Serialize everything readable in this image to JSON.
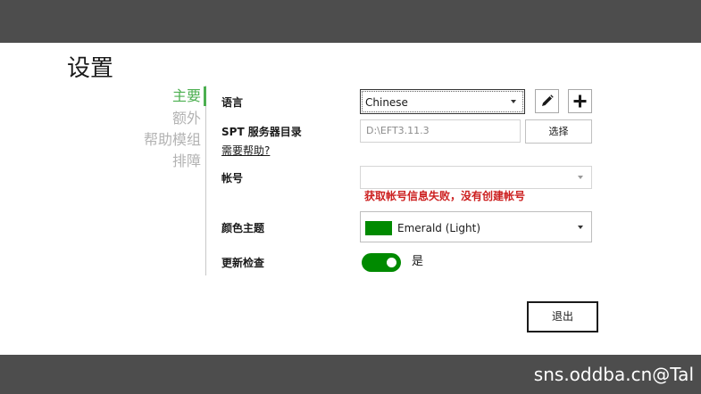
{
  "page": {
    "title": "设置"
  },
  "nav": {
    "items": [
      {
        "label": "主要",
        "active": true
      },
      {
        "label": "额外",
        "active": false
      },
      {
        "label": "帮助模组",
        "active": false
      },
      {
        "label": "排障",
        "active": false
      }
    ],
    "accent_color": "#4caf50"
  },
  "settings": {
    "language": {
      "label": "语言",
      "value": "Chinese"
    },
    "spt_dir": {
      "label": "SPT 服务器目录",
      "value": "D:\\EFT3.11.3",
      "choose_label": "选择",
      "help_link": "需要帮助?"
    },
    "account": {
      "label": "帐号",
      "value": "",
      "error": "获取帐号信息失败，没有创建帐号",
      "error_color": "#cc1f1f"
    },
    "theme": {
      "label": "颜色主题",
      "value": "Emerald (Light)",
      "swatch_color": "#008a00"
    },
    "update_check": {
      "label": "更新检查",
      "value_label": "是",
      "enabled": true
    }
  },
  "actions": {
    "exit_label": "退出"
  },
  "icons": {
    "edit": "pencil-icon",
    "add": "plus-icon"
  },
  "watermark": "sns.oddba.cn@Tal"
}
